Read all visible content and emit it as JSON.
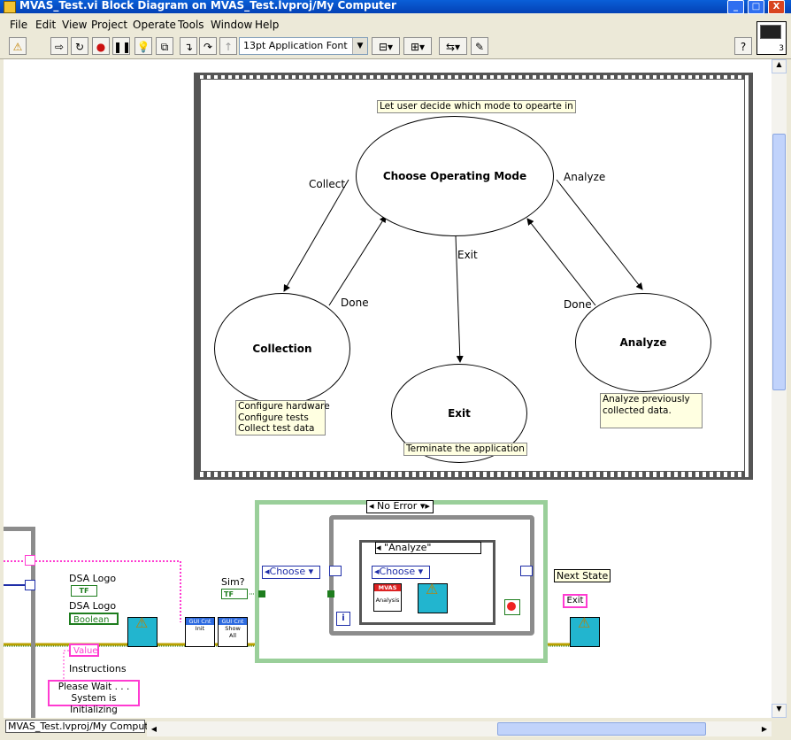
{
  "window": {
    "title": "MVAS_Test.vi Block Diagram on MVAS_Test.lvproj/My Computer",
    "buttons": {
      "minimize": "_",
      "maximize": "□",
      "close": "X"
    }
  },
  "menu": [
    "File",
    "Edit",
    "View",
    "Project",
    "Operate",
    "Tools",
    "Window",
    "Help"
  ],
  "toolbar": {
    "font": "13pt Application Font",
    "help": "?",
    "vi_icon_number": "3"
  },
  "state_diagram": {
    "note_top": "Let user decide which mode to opearte in",
    "states": {
      "choose": "Choose Operating Mode",
      "collection": "Collection",
      "exit": "Exit",
      "analyze": "Analyze"
    },
    "transitions": {
      "collect": "Collect",
      "done_left": "Done",
      "exit": "Exit",
      "analyze": "Analyze",
      "done_right": "Done"
    },
    "notes": {
      "collection": [
        "Configure hardware",
        "Configure tests",
        "Collect test data"
      ],
      "exit": "Terminate the application",
      "analyze": [
        "Analyze previously",
        "collected data."
      ]
    }
  },
  "diagram": {
    "case_selector": "No Error",
    "inner_case": "\"Analyze\"",
    "choose_left": "Choose",
    "choose_inner": "Choose",
    "dsa_logo_label_1": "DSA Logo",
    "dsa_logo_tf": "TF",
    "dsa_logo_label_2": "DSA Logo",
    "boolean": "Boolean",
    "value": "Value",
    "instructions": "Instructions",
    "please_wait": [
      "Please Wait . . .",
      "System is Initializing"
    ],
    "sim_label": "Sim?",
    "sim_tf": "TF",
    "gui_init": [
      "GUI Cnt",
      "Init"
    ],
    "gui_show": [
      "GUI Cnt",
      "Show",
      "All"
    ],
    "mvas": [
      "MVAS",
      "Analysis"
    ],
    "next_state": "Next State",
    "exit": "Exit",
    "info": "i"
  },
  "status": {
    "path": "MVAS_Test.lvproj/My Computer"
  }
}
